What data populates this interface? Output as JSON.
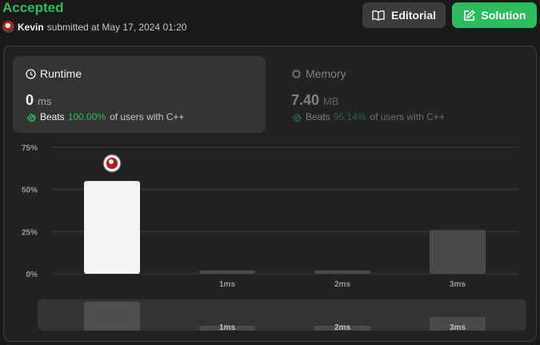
{
  "submission": {
    "status": "Accepted",
    "user": "Kevin",
    "submitted_text": "submitted at May 17, 2024 01:20"
  },
  "header_buttons": {
    "editorial": "Editorial",
    "solution": "Solution"
  },
  "runtime": {
    "title": "Runtime",
    "value": "0",
    "unit": "ms",
    "beats_label": "Beats",
    "beats_pct": "100.00%",
    "beats_suffix": "of users with C++"
  },
  "memory": {
    "title": "Memory",
    "value": "7.40",
    "unit": "MB",
    "beats_label": "Beats",
    "beats_pct": "95.14%",
    "beats_suffix": "of users with C++"
  },
  "colors": {
    "accent": "#2cbb5d",
    "highlight_bar": "#f5f5f5",
    "bar": "#4a4a4a"
  },
  "icons": {
    "editorial": "book-icon",
    "solution": "edit-icon",
    "runtime": "clock-icon",
    "memory": "chip-icon",
    "beats": "clapping-hands-icon"
  },
  "chart_data": {
    "type": "bar",
    "categories": [
      "",
      "1ms",
      "2ms",
      "3ms"
    ],
    "values": [
      55,
      2,
      2,
      26
    ],
    "highlight_index": 0,
    "ylim": [
      0,
      75
    ],
    "yticks": [
      "0%",
      "25%",
      "50%",
      "75%"
    ],
    "grid": true,
    "overview_values": [
      55,
      2,
      2,
      26
    ]
  }
}
